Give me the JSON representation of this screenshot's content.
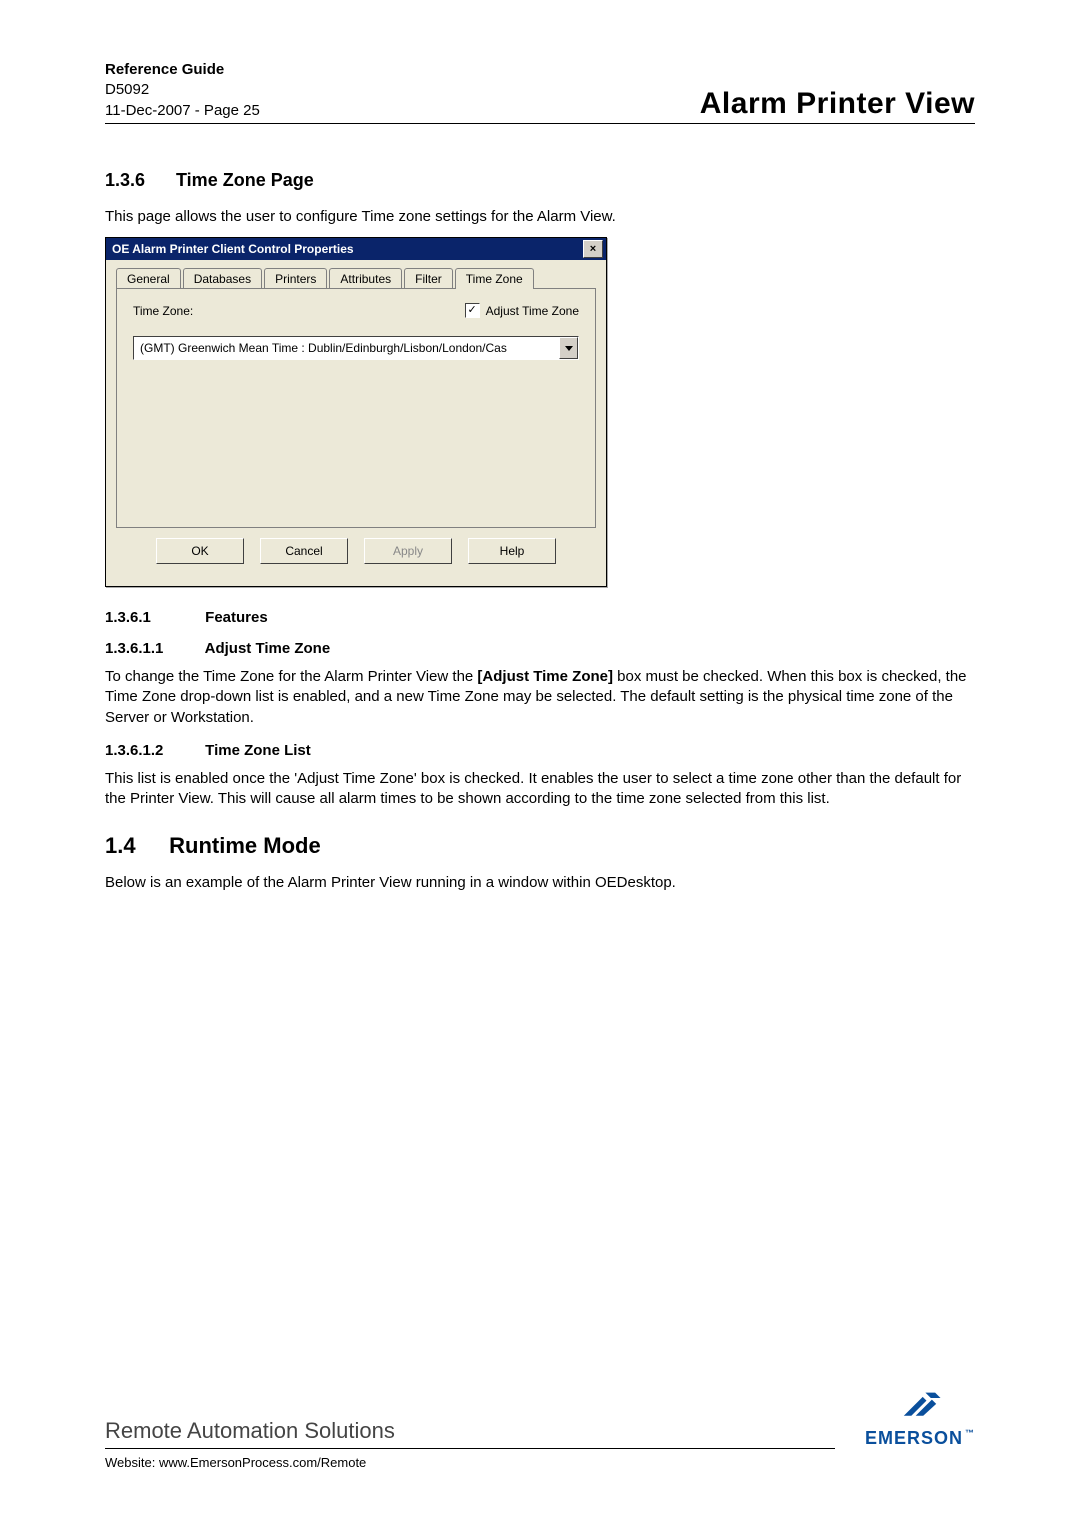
{
  "header": {
    "title": "Reference Guide",
    "doc_id": "D5092",
    "page_line": "11-Dec-2007 - Page 25",
    "section": "Alarm Printer View"
  },
  "sec_136": {
    "num": "1.3.6",
    "title": "Time Zone Page",
    "intro": "This page allows the user to configure Time zone settings for the Alarm View."
  },
  "dialog": {
    "title": "OE Alarm Printer Client Control Properties",
    "close_glyph": "×",
    "tabs": [
      "General",
      "Databases",
      "Printers",
      "Attributes",
      "Filter",
      "Time Zone"
    ],
    "active_tab_index": 5,
    "tz_label": "Time Zone:",
    "adjust_label": "Adjust Time Zone",
    "adjust_checked_glyph": "✓",
    "combo_value": "(GMT) Greenwich Mean Time : Dublin/Edinburgh/Lisbon/London/Cas",
    "buttons": {
      "ok": "OK",
      "cancel": "Cancel",
      "apply": "Apply",
      "help": "Help"
    }
  },
  "sec_1361": {
    "num": "1.3.6.1",
    "title": "Features"
  },
  "sec_13611": {
    "num": "1.3.6.1.1",
    "title": "Adjust Time Zone",
    "body_pre": "To change the Time Zone for the Alarm Printer View the ",
    "body_bold": "[Adjust Time Zone]",
    "body_post": " box must be checked. When this box is checked, the Time Zone drop-down list is enabled, and a new Time Zone may be selected. The default setting is the physical time zone of the Server or Workstation."
  },
  "sec_13612": {
    "num": "1.3.6.1.2",
    "title": "Time Zone List",
    "body": "This list is enabled once the 'Adjust Time Zone' box is checked. It enables the user to select a time zone other than the default for the Printer View. This will cause all alarm times to be shown according to the time zone selected from this list."
  },
  "sec_14": {
    "num": "1.4",
    "title": "Runtime Mode",
    "intro": "Below is an example of the Alarm Printer View running in a window within OEDesktop."
  },
  "footer": {
    "ras": "Remote Automation Solutions",
    "website_label": "Website:  www.EmersonProcess.com/Remote",
    "brand": "EMERSON",
    "tm": "™"
  }
}
